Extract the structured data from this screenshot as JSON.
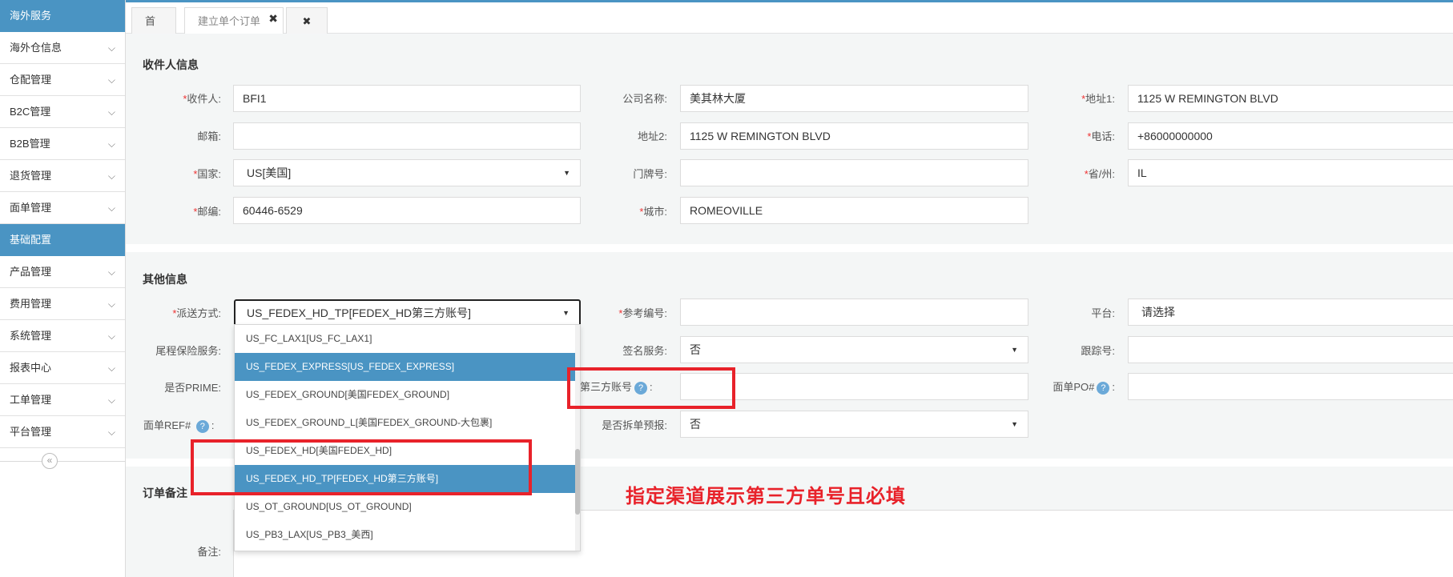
{
  "sidebar": {
    "header_overseas": "海外服务",
    "items_overseas": [
      {
        "label": "海外仓信息"
      },
      {
        "label": "仓配管理"
      },
      {
        "label": "B2C管理"
      },
      {
        "label": "B2B管理"
      },
      {
        "label": "退货管理"
      },
      {
        "label": "面单管理"
      }
    ],
    "header_basic": "基础配置",
    "items_basic": [
      {
        "label": "产品管理"
      },
      {
        "label": "费用管理"
      },
      {
        "label": "系统管理"
      },
      {
        "label": "报表中心"
      },
      {
        "label": "工单管理"
      },
      {
        "label": "平台管理"
      }
    ],
    "collapse_glyph": "«"
  },
  "tabs": {
    "home": "首页",
    "create_order": "建立单个订单",
    "close_glyph": "✖"
  },
  "recipient": {
    "title": "收件人信息",
    "name_label": "收件人:",
    "name_value": "BFI1",
    "company_label": "公司名称:",
    "company_value": "美其林大厦",
    "addr1_label": "地址1:",
    "addr1_value": "1125 W REMINGTON BLVD",
    "email_label": "邮箱:",
    "email_value": "",
    "addr2_label": "地址2:",
    "addr2_value": "1125 W REMINGTON BLVD",
    "phone_label": "电话:",
    "phone_value": "+86000000000",
    "country_label": "国家:",
    "country_value": "US[美国]",
    "door_label": "门牌号:",
    "door_value": "",
    "state_label": "省/州:",
    "state_value": "IL",
    "zip_label": "邮编:",
    "zip_value": "60446-6529",
    "city_label": "城市:",
    "city_value": "ROMEOVILLE"
  },
  "other": {
    "title": "其他信息",
    "delivery_label": "派送方式:",
    "delivery_value": "US_FEDEX_HD_TP[FEDEX_HD第三方账号]",
    "ref_label": "参考编号:",
    "ref_value": "",
    "platform_label": "平台:",
    "platform_value": "请选择",
    "insurance_label": "尾程保险服务:",
    "sign_label": "签名服务:",
    "sign_value": "否",
    "tracking_label": "跟踪号:",
    "tracking_value": "",
    "prime_label": "是否PRIME:",
    "third_party_label": "第三方账号",
    "third_party_value": "",
    "po_label": "面单PO#",
    "po_value": "",
    "ref_hash_label": "面单REF#",
    "split_label": "是否拆单预报:",
    "split_value": "否",
    "help_glyph": "?",
    "colon": ":"
  },
  "delivery_options": [
    {
      "label": "US_FC_LAX1[US_FC_LAX1]",
      "selected": false
    },
    {
      "label": "US_FEDEX_EXPRESS[US_FEDEX_EXPRESS]",
      "selected": true
    },
    {
      "label": "US_FEDEX_GROUND[美国FEDEX_GROUND]",
      "selected": false
    },
    {
      "label": "US_FEDEX_GROUND_L[美国FEDEX_GROUND-大包裹]",
      "selected": false
    },
    {
      "label": "US_FEDEX_HD[美国FEDEX_HD]",
      "selected": false
    },
    {
      "label": "US_FEDEX_HD_TP[FEDEX_HD第三方账号]",
      "selected": true
    },
    {
      "label": "US_OT_GROUND[US_OT_GROUND]",
      "selected": false
    },
    {
      "label": "US_PB3_LAX[US_PB3_美西]",
      "selected": false
    }
  ],
  "remarks": {
    "title": "订单备注",
    "note_label": "备注:"
  },
  "annotation": {
    "text": "指定渠道展示第三方单号且必填",
    "color": "#e8222a"
  },
  "colors": {
    "accent": "#4a94c3",
    "required": "#e33333"
  }
}
